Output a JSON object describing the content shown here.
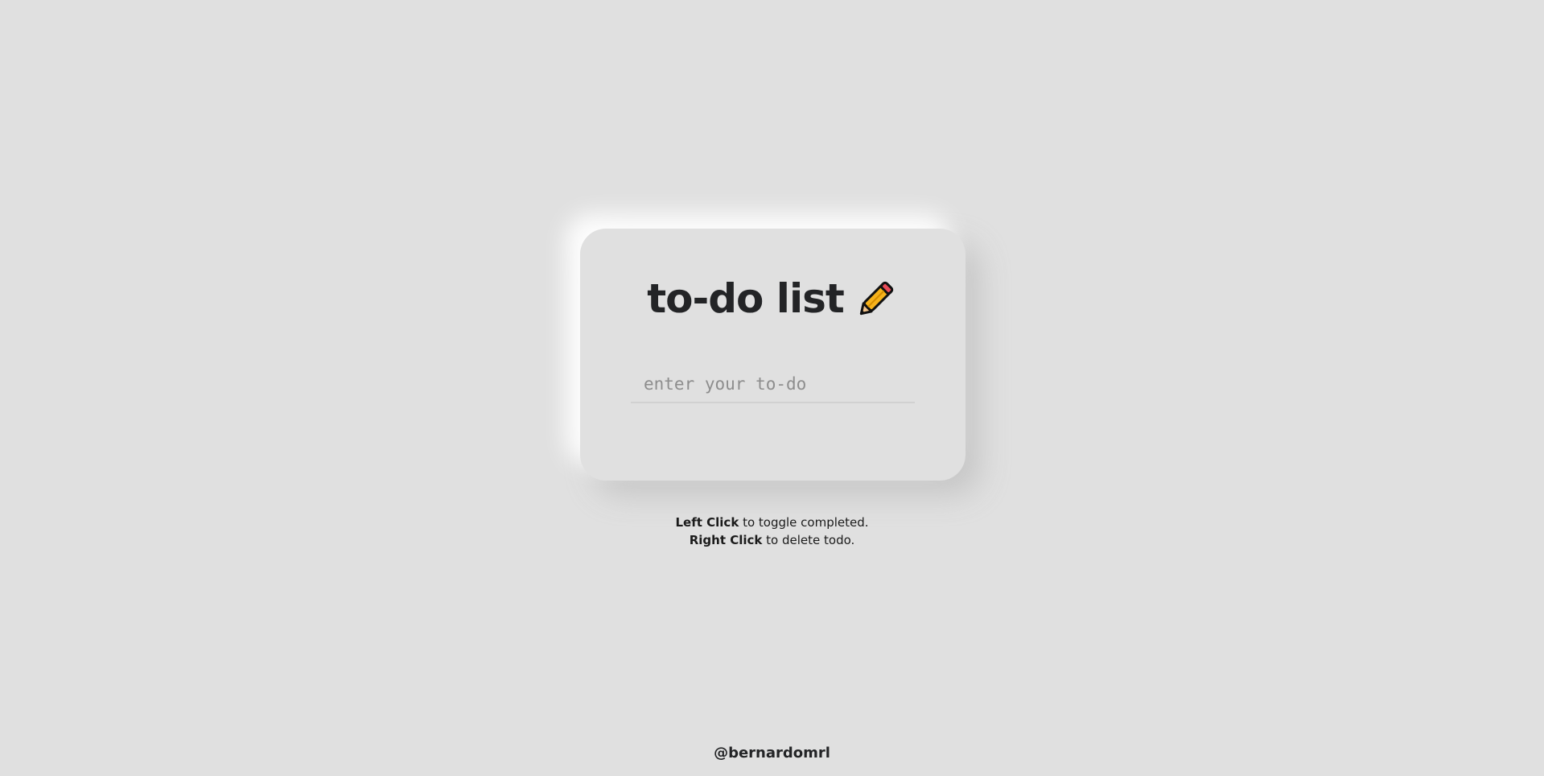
{
  "app": {
    "title": "to-do list",
    "title_icon": "pencil-icon"
  },
  "input": {
    "value": "",
    "placeholder": "enter your to-do"
  },
  "help": {
    "left_click_label": "Left Click",
    "left_click_text": " to toggle completed.",
    "right_click_label": "Right Click",
    "right_click_text": " to delete todo."
  },
  "footer": {
    "handle": "@bernardomrl"
  },
  "colors": {
    "background": "#e0e0e0",
    "text": "#232426",
    "pencil_body": "#f6b21b",
    "pencil_eraser": "#e94b57"
  }
}
